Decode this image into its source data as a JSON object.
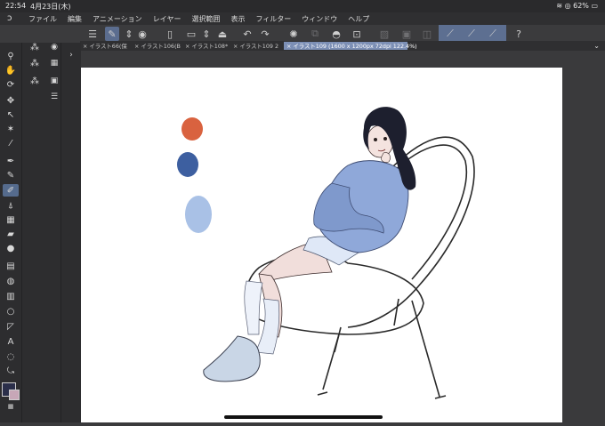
{
  "status": {
    "time": "22:54",
    "date": "4月23日(木)",
    "battery": "62%"
  },
  "menu": {
    "items": [
      "ファイル",
      "編集",
      "アニメーション",
      "レイヤー",
      "選択範囲",
      "表示",
      "フィルター",
      "ウィンドウ",
      "ヘルプ"
    ]
  },
  "tabs": [
    {
      "label": "イラスト66(保",
      "active": false
    },
    {
      "label": "イラスト106(B",
      "active": false
    },
    {
      "label": "イラスト108*",
      "active": false
    },
    {
      "label": "イラスト109 2",
      "active": false
    },
    {
      "label": "イラスト109 (1600 x 1200px 72dpi 122.4%)",
      "active": true
    }
  ],
  "colors": {
    "swatch_orange": "#d9623f",
    "swatch_blue": "#3d5fa0",
    "swatch_lightblue": "#a9c1e6",
    "sweater": "#8fa8d9",
    "hair": "#1d1f2e",
    "main_color": "#2b2f4a",
    "sub_color": "#c7a7b7"
  }
}
